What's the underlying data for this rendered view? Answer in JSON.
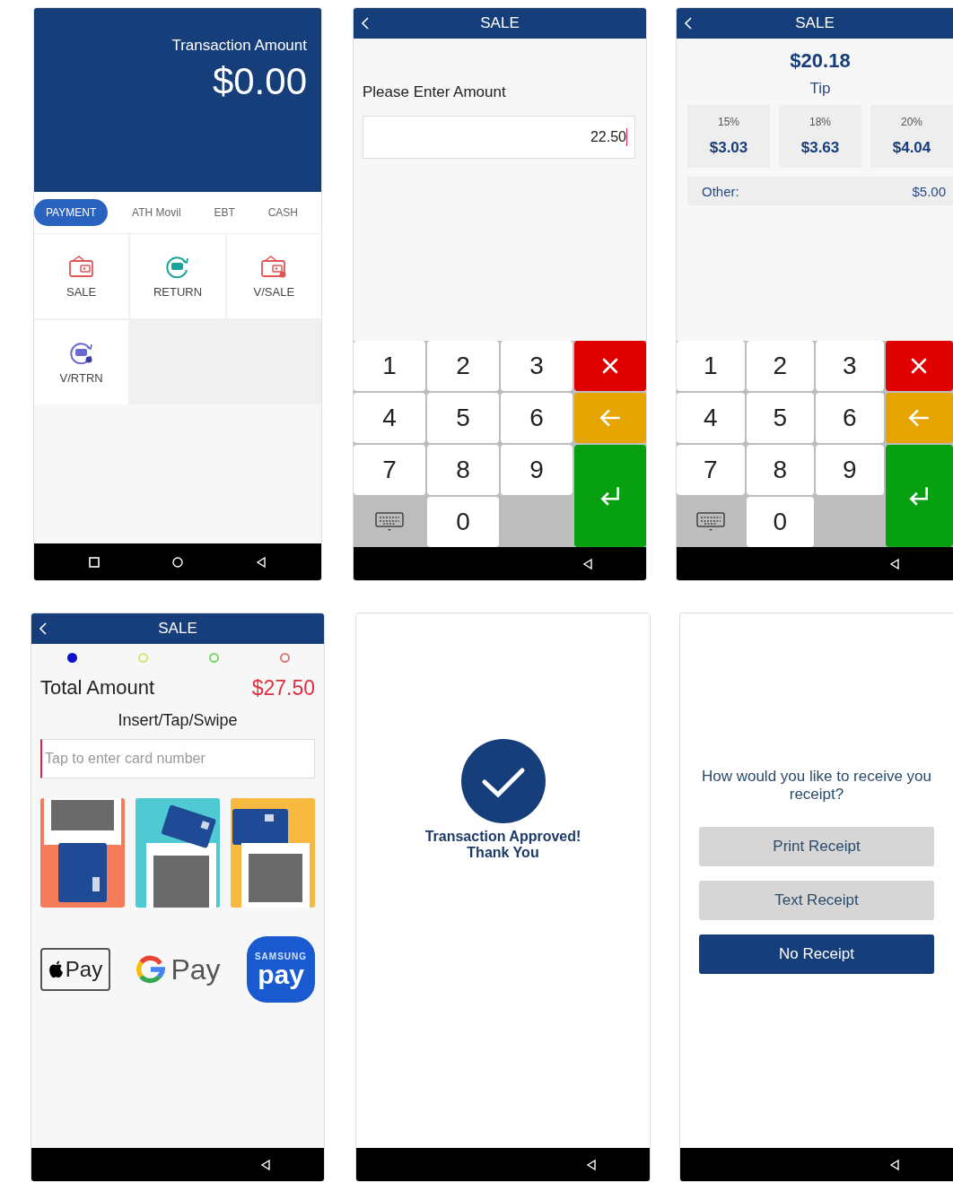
{
  "screens": [
    {
      "kind": "home",
      "header_label": "Transaction Amount",
      "amount": "$0.00",
      "tabs": [
        {
          "label": "PAYMENT",
          "selected": true
        },
        {
          "label": "ATH Movil",
          "selected": false
        },
        {
          "label": "EBT",
          "selected": false
        },
        {
          "label": "CASH",
          "selected": false
        }
      ],
      "actions": [
        {
          "label": "SALE",
          "kind": "wallet"
        },
        {
          "label": "RETURN",
          "kind": "exchange"
        },
        {
          "label": "V/SALE",
          "kind": "wallet-void"
        },
        {
          "label": "V/RTRN",
          "kind": "exchange-void"
        }
      ]
    },
    {
      "kind": "amount",
      "title": "SALE",
      "prompt": "Please Enter Amount",
      "value": "22.50",
      "keys": [
        "1",
        "2",
        "3",
        "4",
        "5",
        "6",
        "7",
        "8",
        "9",
        "0"
      ]
    },
    {
      "kind": "tip",
      "title": "SALE",
      "total": "$20.18",
      "tip_label": "Tip",
      "options": [
        {
          "percent": "15%",
          "amount": "$3.03"
        },
        {
          "percent": "18%",
          "amount": "$3.63"
        },
        {
          "percent": "20%",
          "amount": "$4.04"
        }
      ],
      "other_label": "Other:",
      "other_amount": "$5.00",
      "keys": [
        "1",
        "2",
        "3",
        "4",
        "5",
        "6",
        "7",
        "8",
        "9",
        "0"
      ]
    },
    {
      "kind": "card",
      "title": "SALE",
      "steps": [
        {
          "color": "#1010c8",
          "selected": true
        },
        {
          "color": "#d8e27a",
          "selected": false
        },
        {
          "color": "#7ad86a",
          "selected": false
        },
        {
          "color": "#e07a7a",
          "selected": false
        }
      ],
      "total_label": "Total Amount",
      "total": "$27.50",
      "prompt": "Insert/Tap/Swipe",
      "placeholder": "Tap to enter card number",
      "methods": [
        {
          "kind": "insert"
        },
        {
          "kind": "tap"
        },
        {
          "kind": "swipe"
        }
      ],
      "wallets": [
        {
          "kind": "apple",
          "label": "Pay"
        },
        {
          "kind": "google",
          "label": "Pay"
        },
        {
          "kind": "samsung",
          "brand": "SAMSUNG",
          "label": "pay"
        }
      ]
    },
    {
      "kind": "approved",
      "message": [
        "Transaction Approved!",
        "Thank You"
      ]
    },
    {
      "kind": "receipt",
      "question": [
        "How would you like to receive you",
        "receipt?"
      ],
      "buttons": [
        {
          "label": "Print Receipt",
          "kind": "secondary"
        },
        {
          "label": "Text Receipt",
          "kind": "secondary"
        },
        {
          "label": "No Receipt",
          "kind": "primary"
        }
      ]
    }
  ]
}
